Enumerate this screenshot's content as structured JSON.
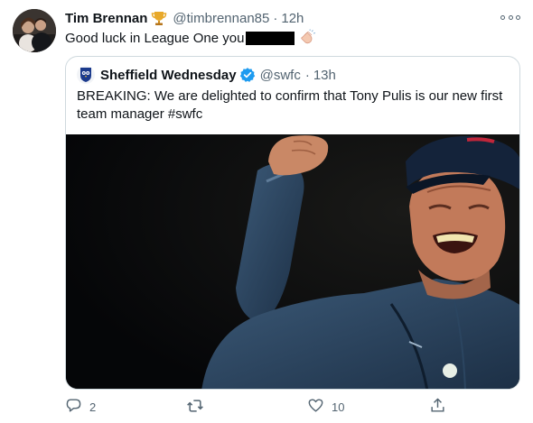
{
  "tweet": {
    "author_name": "Tim Brennan",
    "author_badge_icon": "trophy-icon",
    "handle": "@timbrennan85",
    "separator": "·",
    "time": "12h",
    "text": "Good luck in League One you",
    "emoji_icon": "clapping-hands-icon"
  },
  "quoted_tweet": {
    "author_name": "Sheffield Wednesday",
    "verified_icon": "verified-badge-icon",
    "handle": "@swfc",
    "separator": "·",
    "time": "13h",
    "text": "BREAKING: We are delighted to confirm that Tony Pulis is our new first team manager #swfc",
    "image_description_icon": "photo"
  },
  "actions": {
    "reply_count": "2",
    "retweet_count": "",
    "like_count": "10"
  },
  "colors": {
    "text_primary": "#0f1419",
    "text_secondary": "#536471",
    "verified_blue": "#1d9bf0",
    "border": "#cfd9de"
  }
}
